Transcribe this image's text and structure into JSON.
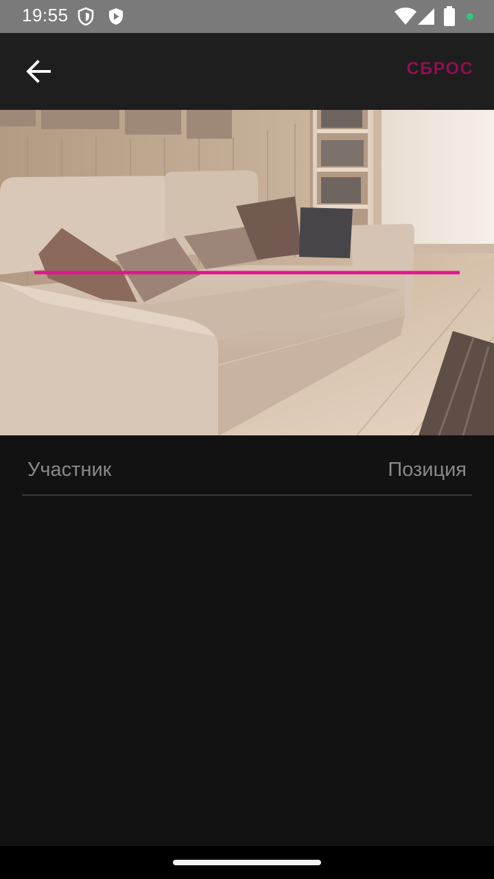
{
  "status_bar": {
    "time": "19:55",
    "icons": [
      "shield-icon",
      "play-protect-icon",
      "wifi-icon",
      "signal-icon",
      "battery-icon",
      "privacy-dot-icon"
    ],
    "privacy_dot_color": "#2ecc71"
  },
  "app_bar": {
    "back_icon": "arrow-left-icon",
    "reset_label": "СБРОС",
    "accent_color": "#8e1150"
  },
  "photo": {
    "subject": "sofa-room-image",
    "line_color": "#e0168e"
  },
  "table": {
    "headers": {
      "participant": "Участник",
      "position": "Позиция"
    },
    "rows": []
  },
  "colors": {
    "background": "#121212",
    "app_bar": "#1e1e1e",
    "status_bar": "#7a7a7a",
    "header_text": "#8a8a8a"
  }
}
